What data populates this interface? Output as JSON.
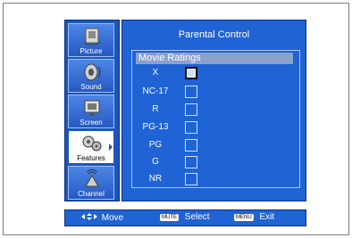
{
  "sidebar": {
    "items": [
      {
        "label": "Picture",
        "icon": "picture-icon",
        "selected": false
      },
      {
        "label": "Sound",
        "icon": "sound-icon",
        "selected": false
      },
      {
        "label": "Screen",
        "icon": "screen-icon",
        "selected": false
      },
      {
        "label": "Features",
        "icon": "features-icon",
        "selected": true
      },
      {
        "label": "Channel",
        "icon": "channel-icon",
        "selected": false
      }
    ]
  },
  "panel": {
    "title": "Parental Control",
    "section": "Movie Ratings",
    "ratings": [
      {
        "label": "X",
        "checked": false,
        "focused": true
      },
      {
        "label": "NC-17",
        "checked": false,
        "focused": false
      },
      {
        "label": "R",
        "checked": false,
        "focused": false
      },
      {
        "label": "PG-13",
        "checked": false,
        "focused": false
      },
      {
        "label": "PG",
        "checked": false,
        "focused": false
      },
      {
        "label": "G",
        "checked": false,
        "focused": false
      },
      {
        "label": "NR",
        "checked": false,
        "focused": false
      }
    ]
  },
  "help": {
    "move_label": "Move",
    "select_key": "MUTE",
    "select_label": "Select",
    "exit_key": "MENU",
    "exit_label": "Exit"
  },
  "colors": {
    "panel_blue": "#1f63d4",
    "header_gray": "#8aa1c9"
  }
}
